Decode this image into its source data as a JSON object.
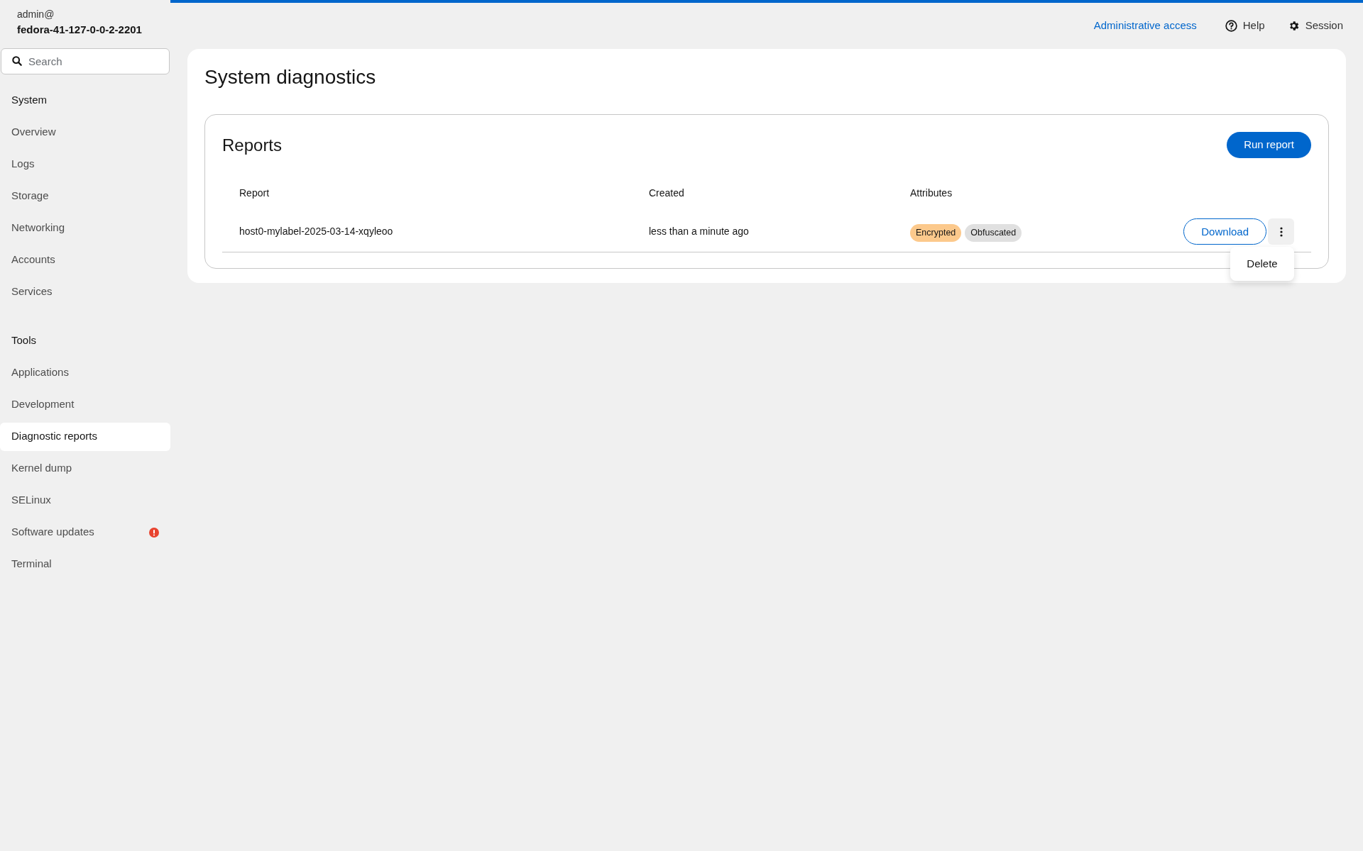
{
  "header": {
    "user": "admin@",
    "host": "fedora-41-127-0-0-2-2201"
  },
  "search": {
    "placeholder": "Search"
  },
  "nav": [
    {
      "title": "System",
      "items": [
        {
          "label": "Overview",
          "selected": false,
          "alert": false
        },
        {
          "label": "Logs",
          "selected": false,
          "alert": false
        },
        {
          "label": "Storage",
          "selected": false,
          "alert": false
        },
        {
          "label": "Networking",
          "selected": false,
          "alert": false
        },
        {
          "label": "Accounts",
          "selected": false,
          "alert": false
        },
        {
          "label": "Services",
          "selected": false,
          "alert": false
        }
      ]
    },
    {
      "title": "Tools",
      "items": [
        {
          "label": "Applications",
          "selected": false,
          "alert": false
        },
        {
          "label": "Development",
          "selected": false,
          "alert": false
        },
        {
          "label": "Diagnostic reports",
          "selected": true,
          "alert": false
        },
        {
          "label": "Kernel dump",
          "selected": false,
          "alert": false
        },
        {
          "label": "SELinux",
          "selected": false,
          "alert": false
        },
        {
          "label": "Software updates",
          "selected": false,
          "alert": true
        },
        {
          "label": "Terminal",
          "selected": false,
          "alert": false
        }
      ]
    }
  ],
  "topbar": {
    "admin_link": "Administrative access",
    "help": "Help",
    "session": "Session"
  },
  "page": {
    "title": "System diagnostics"
  },
  "reports": {
    "title": "Reports",
    "run_button": "Run report",
    "columns": [
      "Report",
      "Created",
      "Attributes"
    ],
    "rows": [
      {
        "name": "host0-mylabel-2025-03-14-xqyleoo",
        "created": "less than a minute ago",
        "attributes": [
          {
            "label": "Encrypted",
            "color": "#fcc98c"
          },
          {
            "label": "Obfuscated",
            "color": "#e0e0e0"
          }
        ],
        "download": "Download",
        "menu": {
          "expanded": true,
          "items": [
            "Delete"
          ]
        }
      }
    ]
  }
}
